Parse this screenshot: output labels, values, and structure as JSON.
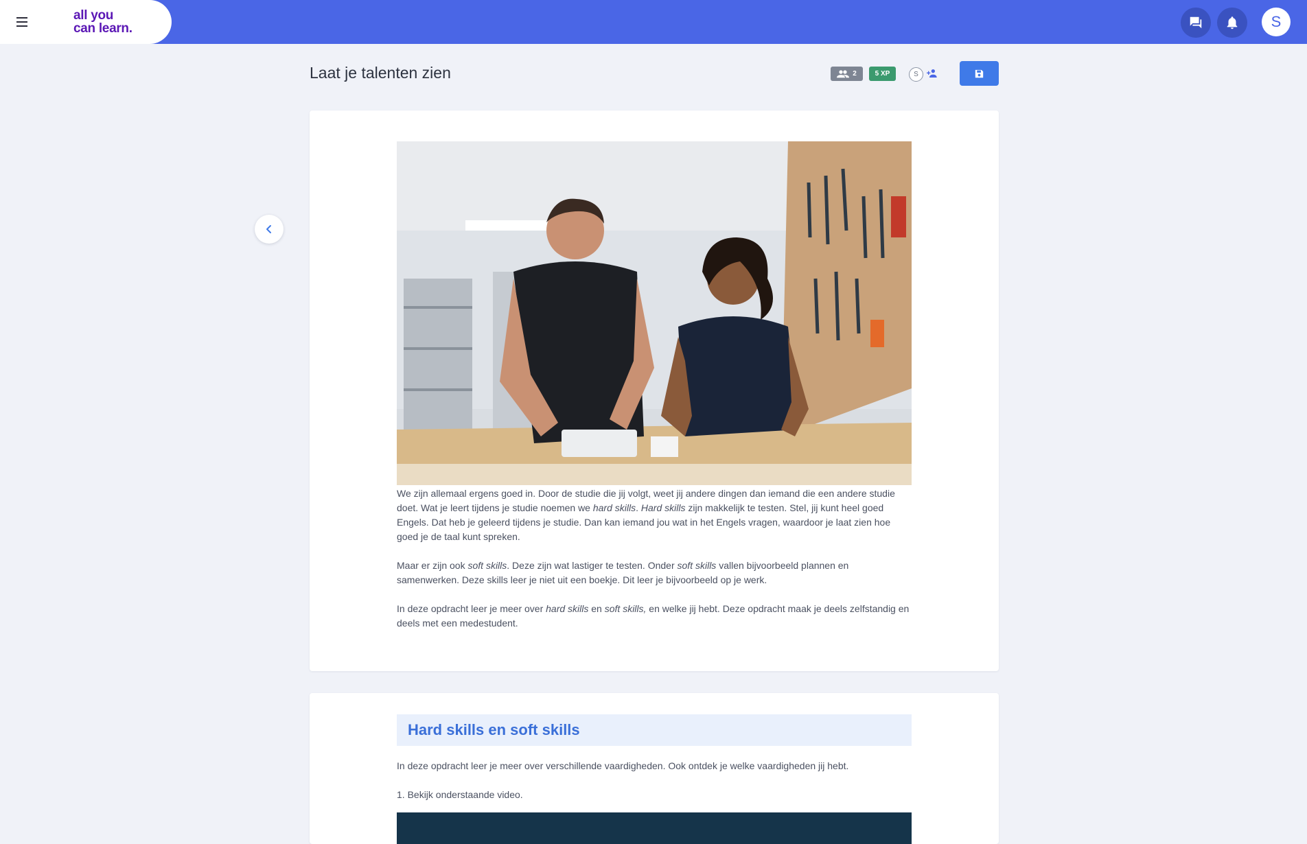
{
  "header": {
    "logo_line1": "all you",
    "logo_line2": "can learn.",
    "avatar_initial": "S",
    "icons": [
      "menu-icon",
      "chat-icon",
      "bell-icon"
    ]
  },
  "page": {
    "title": "Laat je talenten zien",
    "members_count": "2",
    "xp_label": "5 XP",
    "mini_avatar_initial": "S"
  },
  "intro": {
    "p1_a": "We zijn allemaal ergens goed in. Door de studie die jij volgt, weet jij andere dingen dan iemand die een andere studie doet. Wat je leert tijdens je studie noemen we ",
    "p1_em1": "hard skills",
    "p1_b": ". ",
    "p1_em2": "Hard skills",
    "p1_c": " zijn makkelijk te testen. Stel, jij kunt heel goed Engels. Dat heb je geleerd tijdens je studie. Dan kan iemand jou wat in het Engels vragen, waardoor je laat zien hoe goed je de taal kunt spreken.",
    "p2_a": "Maar er zijn ook ",
    "p2_em1": "soft skills",
    "p2_b": ". Deze zijn wat lastiger te testen. Onder ",
    "p2_em2": "soft skills",
    "p2_c": " vallen bijvoorbeeld plannen en samenwerken. Deze skills leer je niet uit een boekje. Dit leer je bijvoorbeeld op je werk.",
    "p3_a": "In deze opdracht leer je meer over ",
    "p3_em1": "hard skills",
    "p3_b": " en ",
    "p3_em2": "soft skills,",
    "p3_c": " en welke jij hebt. Deze opdracht maak je deels zelfstandig en deels met een medestudent."
  },
  "section2": {
    "heading": "Hard skills en soft skills",
    "text": "In deze opdracht leer je meer over verschillende vaardigheden. Ook ontdek je welke vaardigheden jij hebt.",
    "step1": "1. Bekijk onderstaande video."
  },
  "colors": {
    "brand_blue": "#4a66e6",
    "logo_purple": "#5b17b5",
    "xp_green": "#3b9a6e",
    "heading_blue": "#3a6fd8"
  }
}
